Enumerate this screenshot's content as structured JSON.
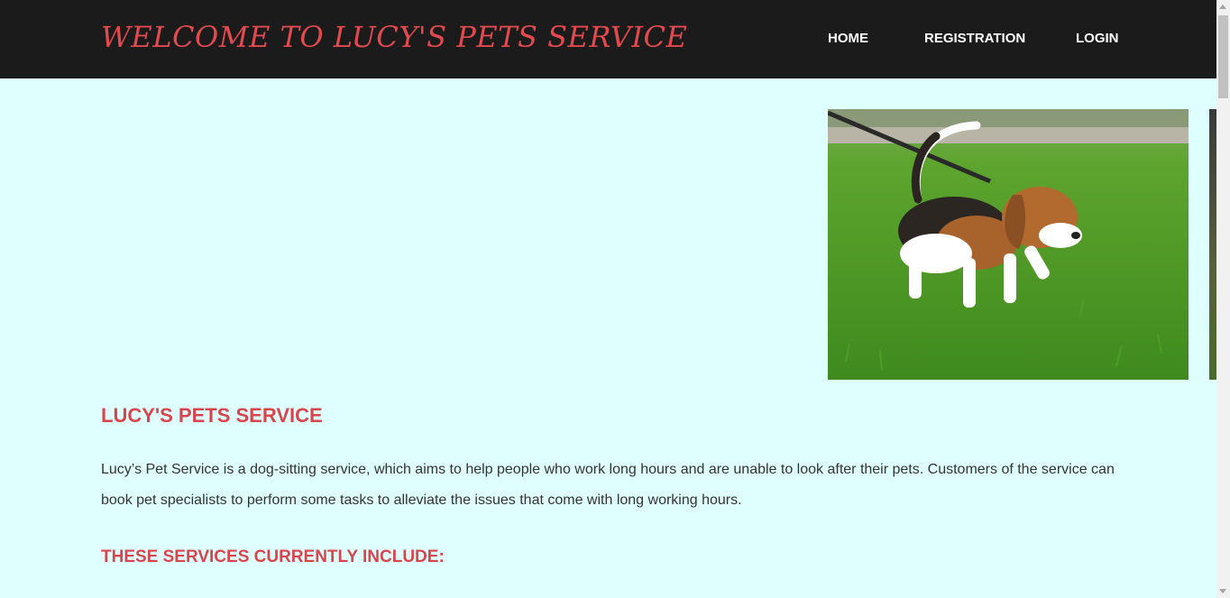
{
  "header": {
    "title": "WELCOME TO LUCY'S PETS SERVICE",
    "nav": {
      "home": "HOME",
      "registration": "REGISTRATION",
      "login": "LOGIN"
    }
  },
  "hero": {
    "image_icon": "beagle-puppy-on-leash-photo"
  },
  "main": {
    "heading": "LUCY'S PETS SERVICE",
    "intro": "Lucy’s Pet Service is a dog-sitting service, which aims to help people who work long hours and are unable to look after their pets. Customers of the service can book pet specialists to perform some tasks to alleviate the issues that come with long working hours.",
    "services_heading": "THESE SERVICES CURRENTLY INCLUDE:"
  },
  "colors": {
    "accent": "#e34a4f",
    "header_bg": "#1b1b1b",
    "page_bg": "#dfffff"
  }
}
